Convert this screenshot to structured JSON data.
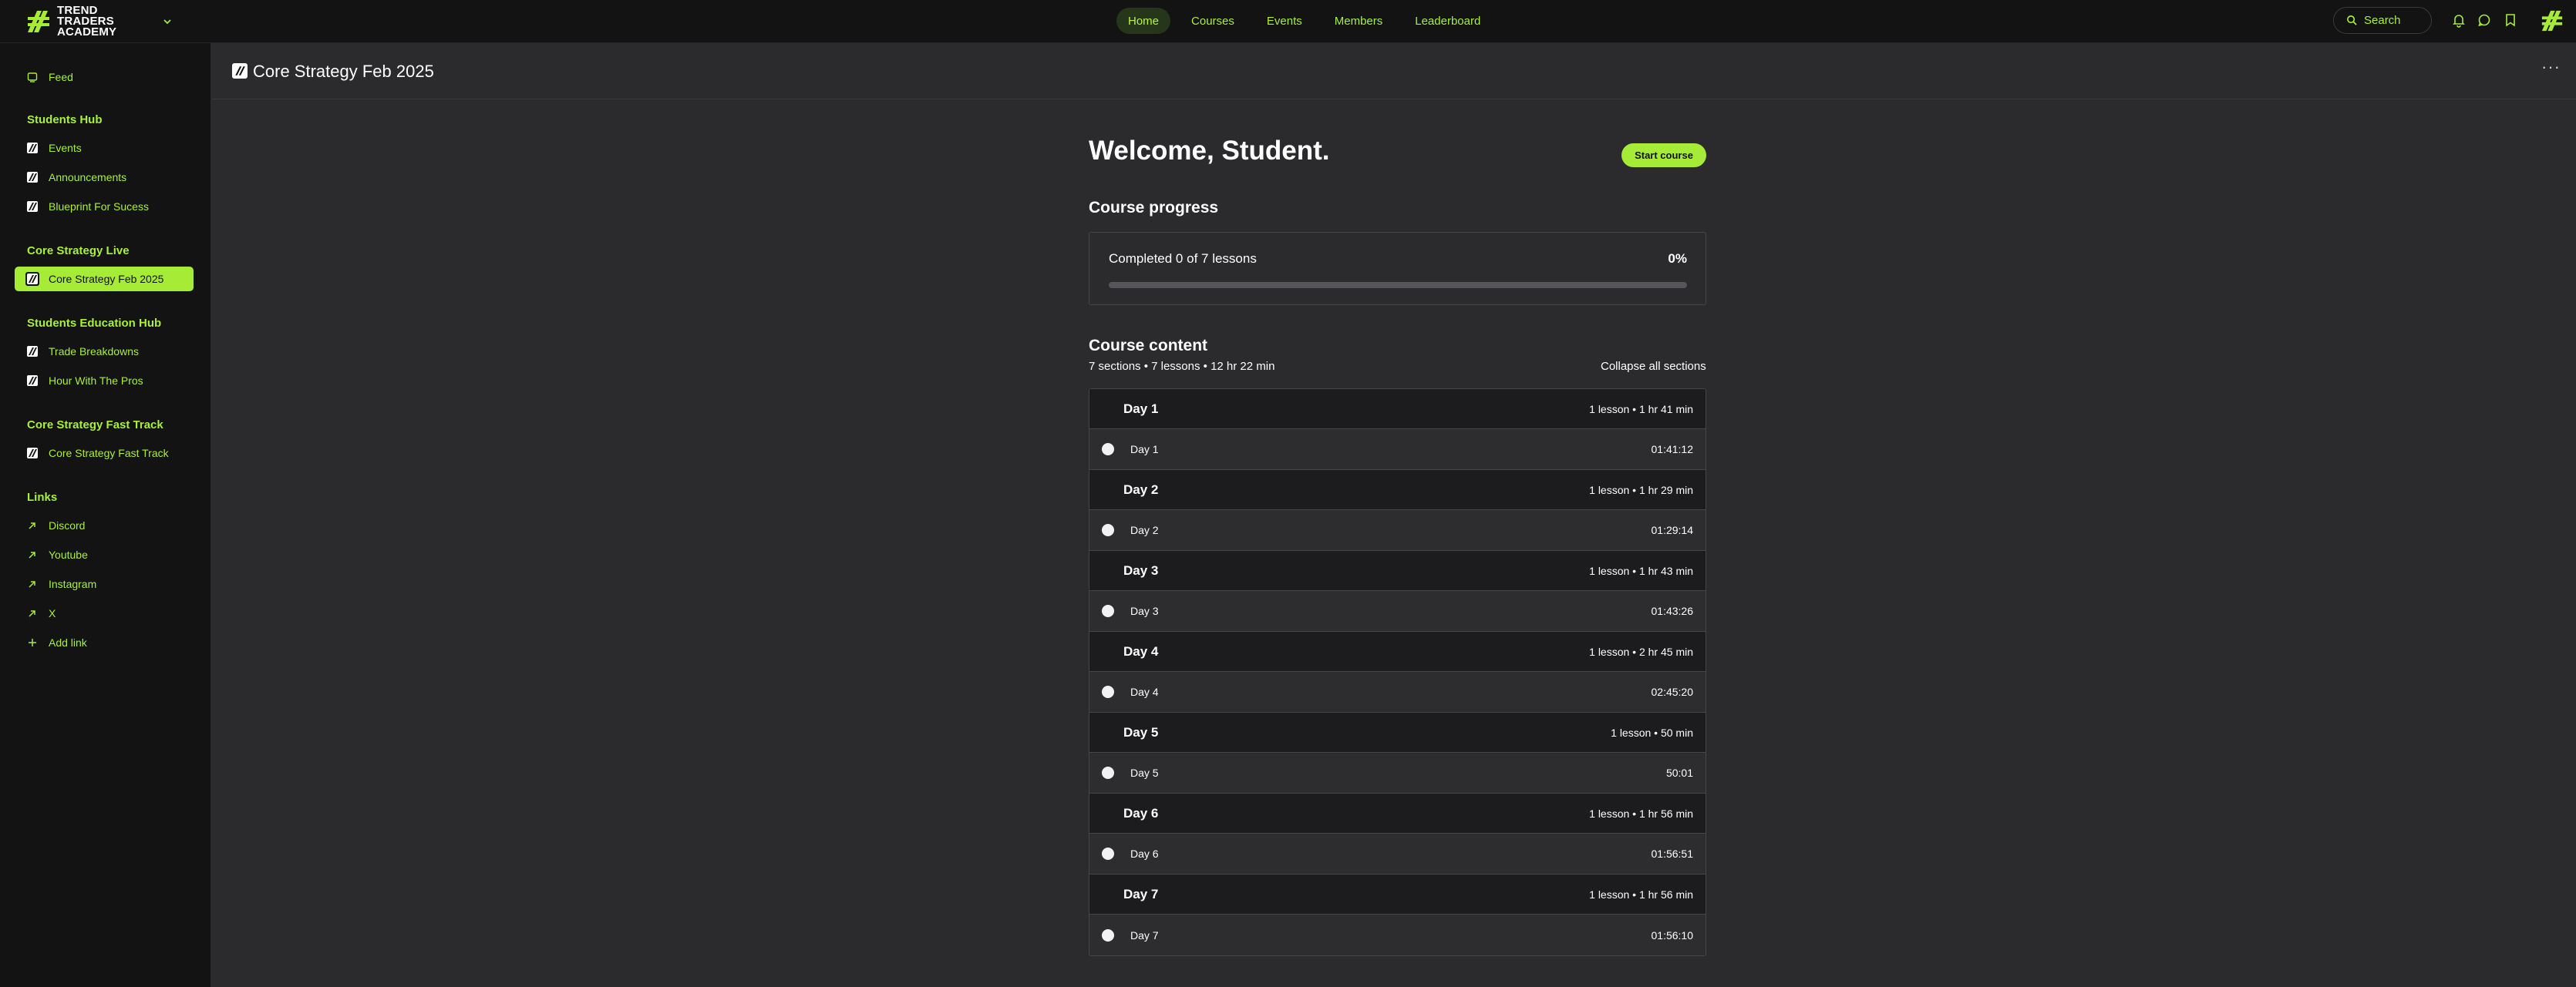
{
  "brand": {
    "name": "TREND TRADERS\nACADEMY"
  },
  "nav": [
    {
      "label": "Home",
      "active": true
    },
    {
      "label": "Courses"
    },
    {
      "label": "Events"
    },
    {
      "label": "Members"
    },
    {
      "label": "Leaderboard"
    }
  ],
  "search": {
    "placeholder": "Search"
  },
  "colors": {
    "accent": "#a6ec37",
    "background": "#2b2b2e",
    "sidebar": "#131314"
  },
  "sidebar": {
    "feed": "Feed",
    "students_hub": {
      "heading": "Students Hub",
      "items": [
        "Events",
        "Announcements",
        "Blueprint For Sucess"
      ]
    },
    "core_strategy_live": {
      "heading": "Core Strategy Live",
      "items": [
        "Core Strategy Feb 2025"
      ]
    },
    "education_hub": {
      "heading": "Students Education Hub",
      "items": [
        "Trade Breakdowns",
        "Hour With The Pros"
      ]
    },
    "fast_track": {
      "heading": "Core Strategy Fast Track",
      "items": [
        "Core Strategy Fast Track"
      ]
    },
    "links": {
      "heading": "Links",
      "items": [
        "Discord",
        "Youtube",
        "Instagram",
        "X"
      ],
      "add": "Add link"
    }
  },
  "page": {
    "title": "Core Strategy Feb 2025",
    "welcome": "Welcome, Student.",
    "start_button": "Start course",
    "progress_heading": "Course progress",
    "progress_label": "Completed 0 of 7 lessons",
    "progress_percent": "0%",
    "progress_value": 0,
    "content_heading": "Course content",
    "content_meta": "7 sections • 7 lessons • 12 hr 22 min",
    "collapse_label": "Collapse all sections"
  },
  "sections": [
    {
      "title": "Day 1",
      "meta": "1 lesson • 1 hr 41 min",
      "lesson": "Day 1",
      "duration": "01:41:12"
    },
    {
      "title": "Day 2",
      "meta": "1 lesson • 1 hr 29 min",
      "lesson": "Day 2",
      "duration": "01:29:14"
    },
    {
      "title": "Day 3",
      "meta": "1 lesson • 1 hr 43 min",
      "lesson": "Day 3",
      "duration": "01:43:26"
    },
    {
      "title": "Day 4",
      "meta": "1 lesson • 2 hr 45 min",
      "lesson": "Day 4",
      "duration": "02:45:20"
    },
    {
      "title": "Day 5",
      "meta": "1 lesson • 50 min",
      "lesson": "Day 5",
      "duration": "50:01"
    },
    {
      "title": "Day 6",
      "meta": "1 lesson • 1 hr 56 min",
      "lesson": "Day 6",
      "duration": "01:56:51"
    },
    {
      "title": "Day 7",
      "meta": "1 lesson • 1 hr 56 min",
      "lesson": "Day 7",
      "duration": "01:56:10"
    }
  ]
}
